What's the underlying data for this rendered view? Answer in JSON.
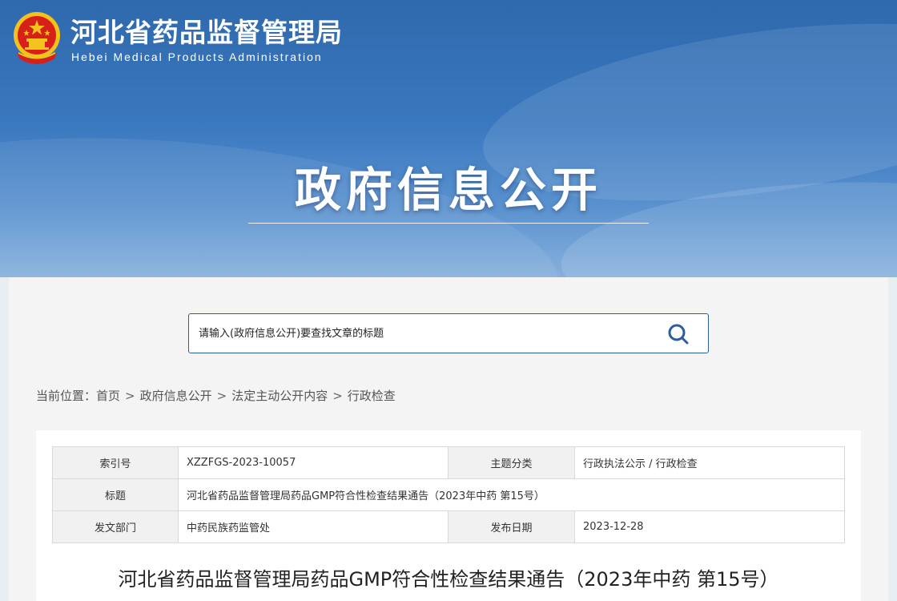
{
  "header": {
    "site_title": "河北省药品监督管理局",
    "site_subtitle": "Hebei Medical Products Administration",
    "section_title": "政府信息公开"
  },
  "search": {
    "placeholder": "请输入(政府信息公开)要查找文章的标题",
    "icon": "search-icon"
  },
  "breadcrumb": {
    "prefix": "当前位置：",
    "items": [
      "首页",
      "政府信息公开",
      "法定主动公开内容",
      "行政检查"
    ],
    "separator": ">"
  },
  "meta": {
    "index_label": "索引号",
    "index_value": "XZZFGS-2023-10057",
    "category_label": "主题分类",
    "category_value": "行政执法公示 / 行政检查",
    "title_label": "标题",
    "title_value": "河北省药品监督管理局药品GMP符合性检查结果通告（2023年中药 第15号）",
    "dept_label": "发文部门",
    "dept_value": "中药民族药监管处",
    "date_label": "发布日期",
    "date_value": "2023-12-28"
  },
  "article": {
    "title": "河北省药品监督管理局药品GMP符合性检查结果通告（2023年中药 第15号）"
  },
  "colors": {
    "header_blue": "#2f69ad",
    "emblem_red": "#d7201a",
    "emblem_gold": "#f4c21c",
    "search_border": "#2d5d9a"
  }
}
